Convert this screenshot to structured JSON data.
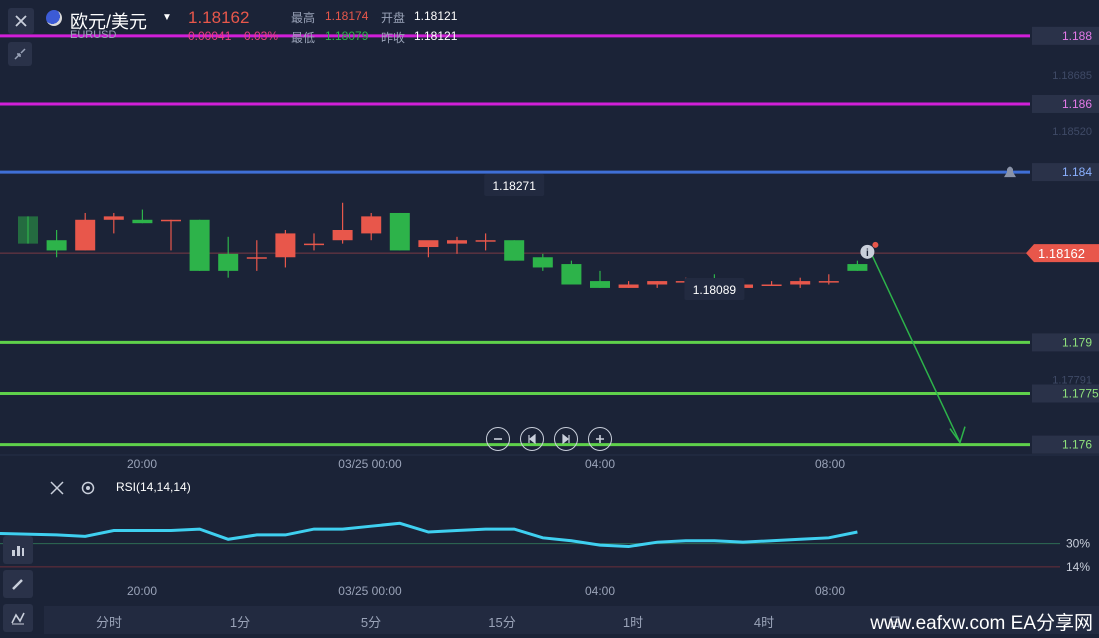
{
  "header": {
    "symbol_name": "欧元/美元",
    "symbol_code": "EURUSD",
    "price": "1.18162",
    "change": "0.00041",
    "change_pct": "0.03%",
    "high_label": "最高",
    "high": "1.18174",
    "low_label": "最低",
    "low": "1.18079",
    "open_label": "开盘",
    "open": "1.18121",
    "prev_label": "昨收",
    "prev": "1.18121"
  },
  "colors": {
    "up": "#e8574b",
    "down": "#2db34a",
    "bg": "#1b2337",
    "blue": "#3f6fd6",
    "magenta": "#d11fd8",
    "green_line": "#5fd14b",
    "rsi": "#3fd0f0",
    "current_tag": "#e8574b"
  },
  "indicator": {
    "label": "RSI(14,14,14)"
  },
  "timeframes": [
    "分时",
    "1分",
    "5分",
    "15分",
    "1时",
    "4时",
    "日"
  ],
  "watermark": "www.eafxw.com  EA分享网",
  "chart_data": {
    "type": "candlestick",
    "ylim": [
      1.1759,
      1.1887
    ],
    "x_tick_labels": [
      "20:00",
      "03/25 00:00",
      "04:00",
      "08:00"
    ],
    "y_axis_labels": [
      "1.18685",
      "1.18520",
      "1.17791"
    ],
    "current_price": "1.18162",
    "horizontal_lines": [
      {
        "label": "1.188",
        "value": 1.188,
        "color": "#d11fd8"
      },
      {
        "label": "1.186",
        "value": 1.186,
        "color": "#d11fd8"
      },
      {
        "label": "1.184",
        "value": 1.184,
        "color": "#3f6fd6"
      },
      {
        "label": "1.179",
        "value": 1.179,
        "color": "#5fd14b"
      },
      {
        "label": "1.1775",
        "value": 1.1775,
        "color": "#5fd14b"
      },
      {
        "label": "1.176",
        "value": 1.176,
        "color": "#5fd14b"
      }
    ],
    "annotations": [
      {
        "label": "1.18271",
        "type": "high"
      },
      {
        "label": "1.18089",
        "type": "low"
      }
    ],
    "candles": [
      {
        "o": 1.1827,
        "h": 1.1827,
        "l": 1.1819,
        "c": 1.1819
      },
      {
        "o": 1.182,
        "h": 1.1823,
        "l": 1.1815,
        "c": 1.1817
      },
      {
        "o": 1.1817,
        "h": 1.1828,
        "l": 1.1817,
        "c": 1.1826
      },
      {
        "o": 1.1826,
        "h": 1.1828,
        "l": 1.1822,
        "c": 1.1827
      },
      {
        "o": 1.1826,
        "h": 1.1829,
        "l": 1.1825,
        "c": 1.1825
      },
      {
        "o": 1.1826,
        "h": 1.1826,
        "l": 1.1817,
        "c": 1.1826
      },
      {
        "o": 1.1826,
        "h": 1.1826,
        "l": 1.1811,
        "c": 1.1811
      },
      {
        "o": 1.1816,
        "h": 1.1821,
        "l": 1.1809,
        "c": 1.1811
      },
      {
        "o": 1.1815,
        "h": 1.182,
        "l": 1.1811,
        "c": 1.1815
      },
      {
        "o": 1.1815,
        "h": 1.1823,
        "l": 1.1812,
        "c": 1.1822
      },
      {
        "o": 1.1819,
        "h": 1.1822,
        "l": 1.1817,
        "c": 1.1819
      },
      {
        "o": 1.182,
        "h": 1.1831,
        "l": 1.1819,
        "c": 1.1823
      },
      {
        "o": 1.1822,
        "h": 1.1828,
        "l": 1.182,
        "c": 1.1827
      },
      {
        "o": 1.1828,
        "h": 1.1828,
        "l": 1.1817,
        "c": 1.1817
      },
      {
        "o": 1.1818,
        "h": 1.1819,
        "l": 1.1815,
        "c": 1.182
      },
      {
        "o": 1.1819,
        "h": 1.1821,
        "l": 1.1816,
        "c": 1.182
      },
      {
        "o": 1.182,
        "h": 1.1822,
        "l": 1.1817,
        "c": 1.182
      },
      {
        "o": 1.182,
        "h": 1.182,
        "l": 1.1814,
        "c": 1.1814
      },
      {
        "o": 1.1815,
        "h": 1.1816,
        "l": 1.1811,
        "c": 1.1812
      },
      {
        "o": 1.1813,
        "h": 1.1814,
        "l": 1.1807,
        "c": 1.1807
      },
      {
        "o": 1.1808,
        "h": 1.1811,
        "l": 1.1806,
        "c": 1.1806
      },
      {
        "o": 1.1806,
        "h": 1.1808,
        "l": 1.1806,
        "c": 1.1807
      },
      {
        "o": 1.1807,
        "h": 1.1808,
        "l": 1.1806,
        "c": 1.1808
      },
      {
        "o": 1.1808,
        "h": 1.1809,
        "l": 1.1807,
        "c": 1.1808
      },
      {
        "o": 1.1808,
        "h": 1.181,
        "l": 1.1805,
        "c": 1.1806
      },
      {
        "o": 1.1806,
        "h": 1.1808,
        "l": 1.1805,
        "c": 1.1807
      },
      {
        "o": 1.1807,
        "h": 1.1808,
        "l": 1.1807,
        "c": 1.1807
      },
      {
        "o": 1.1807,
        "h": 1.1809,
        "l": 1.1806,
        "c": 1.1808
      },
      {
        "o": 1.1808,
        "h": 1.181,
        "l": 1.1807,
        "c": 1.1808
      },
      {
        "o": 1.1813,
        "h": 1.1814,
        "l": 1.1811,
        "c": 1.1811
      }
    ],
    "forecast": {
      "from": 1.1816,
      "to": 1.176
    },
    "rsi": {
      "label": "RSI(14,14,14)",
      "levels": [
        {
          "label": "30%",
          "value": 30
        },
        {
          "label": "14%",
          "value": 14
        }
      ],
      "values": [
        37,
        36,
        35,
        39,
        39,
        39,
        40,
        33,
        36,
        36,
        40,
        40,
        42,
        44,
        38,
        39,
        40,
        40,
        34,
        32,
        29,
        28,
        31,
        32,
        32,
        31,
        32,
        33,
        34,
        38
      ]
    }
  }
}
